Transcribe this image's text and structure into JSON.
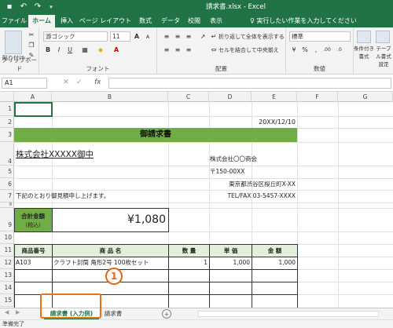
{
  "title_bar": {
    "title": "請求書.xlsx  -  Excel",
    "qa_icons": [
      "save-icon",
      "undo-icon",
      "redo-icon",
      "customize-icon"
    ]
  },
  "tabs": [
    "ファイル",
    "ホーム",
    "挿入",
    "ページ レイアウト",
    "数式",
    "データ",
    "校閲",
    "表示"
  ],
  "tell_me": "♀ 実行したい作業を入力してください",
  "ribbon": {
    "clipboard": {
      "label": "クリップボード",
      "paste": "貼り付け"
    },
    "font": {
      "label": "フォント",
      "name": "游ゴシック",
      "size": "11",
      "bold": "B",
      "italic": "I",
      "underline": "U",
      "grow": "A",
      "shrink": "A"
    },
    "align": {
      "label": "配置",
      "wrap": "折り返して全体を表示する",
      "merge": "セルを結合して中央揃え"
    },
    "number": {
      "label": "数値",
      "format": "標準",
      "pct": "%",
      "comma": ",",
      "inc": ".00",
      "dec": ".0"
    },
    "styles": {
      "cond": "条件付き書式",
      "table": "テーブル書式設定"
    }
  },
  "formula_bar": {
    "name_box": "A1",
    "fx": "fx",
    "value": ""
  },
  "columns": [
    "A",
    "B",
    "C",
    "D",
    "E",
    "F",
    "G"
  ],
  "rows": [
    "1",
    "2",
    "3",
    "4",
    "5",
    "6",
    "7",
    "8",
    "9",
    "10",
    "11",
    "12",
    "13",
    "14",
    "15"
  ],
  "invoice": {
    "date": "20XX/12/10",
    "heading": "御請求書",
    "customer": "株式会社XXXXX御中",
    "company": "株式会社〇〇商会",
    "postal": "〒150-00XX",
    "address": "東京都渋谷区桜丘町X-XX",
    "phone": "TEL/FAX 03-5457-XXXX",
    "intro": "下記のとおり御見積申し上げます。",
    "total_label": "合計金額",
    "total_sub": "（税込）",
    "total_value": "¥1,080",
    "headers": [
      "商品番号",
      "商 品 名",
      "数 量",
      "単 価",
      "金 額"
    ],
    "item": {
      "code": "A103",
      "name": "クラフト封筒 角形2号 100枚セット",
      "qty": "1",
      "price": "1,000",
      "amount": "1,000"
    }
  },
  "sheet_tabs": {
    "active": "請求書 (入力例)",
    "other": "請求書",
    "add": "+"
  },
  "status": "準備完了",
  "callout": "1",
  "colors": {
    "excel_green": "#217346",
    "header_green": "#70ad47",
    "light_green": "#e2efda",
    "callout": "#ec7016"
  }
}
